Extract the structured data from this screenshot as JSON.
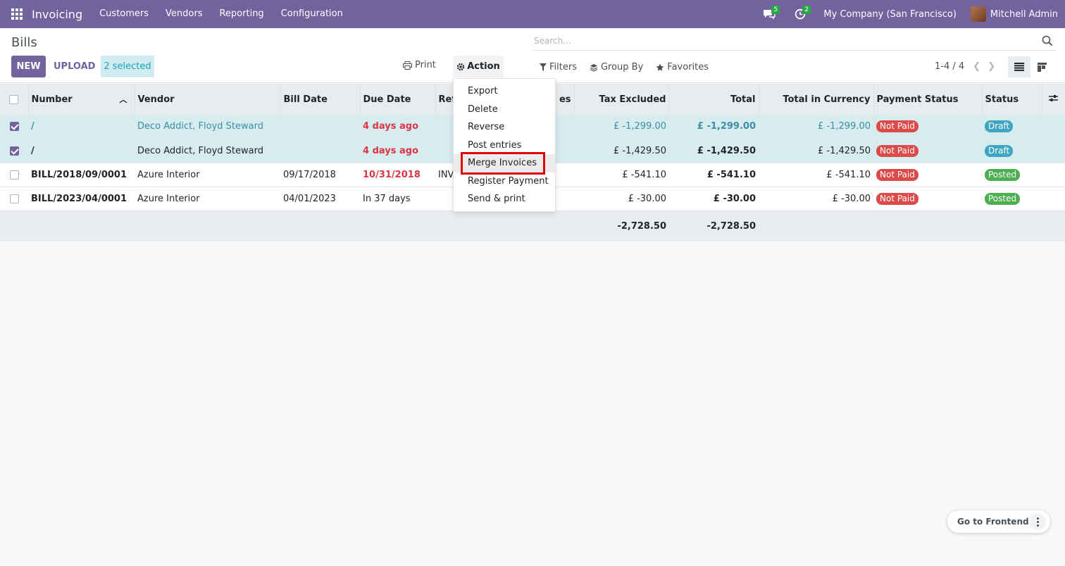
{
  "navbar": {
    "app_name": "Invoicing",
    "menu": [
      "Customers",
      "Vendors",
      "Reporting",
      "Configuration"
    ],
    "messages_count": "5",
    "activities_count": "2",
    "company": "My Company (San Francisco)",
    "user": "Mitchell Admin",
    "bg_color": "#71639e"
  },
  "control_panel": {
    "title": "Bills",
    "new_label": "NEW",
    "upload_label": "UPLOAD",
    "selected_label": "2 selected",
    "print_label": "Print",
    "action_label": "Action",
    "search_placeholder": "Search...",
    "filters_label": "Filters",
    "groupby_label": "Group By",
    "favorites_label": "Favorites",
    "pager": "1-4 / 4"
  },
  "table": {
    "headers": [
      "Number",
      "Vendor",
      "Bill Date",
      "Due Date",
      "Ref",
      "es",
      "Tax Excluded",
      "Total",
      "Total in Currency",
      "Payment Status",
      "Status"
    ],
    "rows": [
      {
        "selected": true,
        "number": "/",
        "vendor": "Deco Addict, Floyd Steward",
        "bill_date": "",
        "due_date": "4 days ago",
        "ref": "",
        "tax_excluded": "£ -1,299.00",
        "total": "£ -1,299.00",
        "total_currency": "£ -1,299.00",
        "payment_status": "Not Paid",
        "status": "Draft"
      },
      {
        "selected": true,
        "number": "/",
        "vendor": "Deco Addict, Floyd Steward",
        "bill_date": "",
        "due_date": "4 days ago",
        "ref": "",
        "tax_excluded": "£ -1,429.50",
        "total": "£ -1,429.50",
        "total_currency": "£ -1,429.50",
        "payment_status": "Not Paid",
        "status": "Draft"
      },
      {
        "selected": false,
        "number": "BILL/2018/09/0001",
        "vendor": "Azure Interior",
        "bill_date": "09/17/2018",
        "due_date": "10/31/2018",
        "ref": "INV",
        "tax_excluded": "£ -541.10",
        "total": "£ -541.10",
        "total_currency": "£ -541.10",
        "payment_status": "Not Paid",
        "status": "Posted"
      },
      {
        "selected": false,
        "number": "BILL/2023/04/0001",
        "vendor": "Azure Interior",
        "bill_date": "04/01/2023",
        "due_date": "In 37 days",
        "ref": "",
        "tax_excluded": "£ -30.00",
        "total": "£ -30.00",
        "total_currency": "£ -30.00",
        "payment_status": "Not Paid",
        "status": "Posted"
      }
    ],
    "footer": {
      "tax_excluded": "-2,728.50",
      "total": "-2,728.50"
    }
  },
  "action_menu": {
    "items": [
      "Export",
      "Delete",
      "Reverse",
      "Post entries",
      "Merge Invoices",
      "Register Payment",
      "Send & print"
    ],
    "highlighted": "Merge Invoices"
  },
  "floating": {
    "frontend_label": "Go to Frontend"
  }
}
